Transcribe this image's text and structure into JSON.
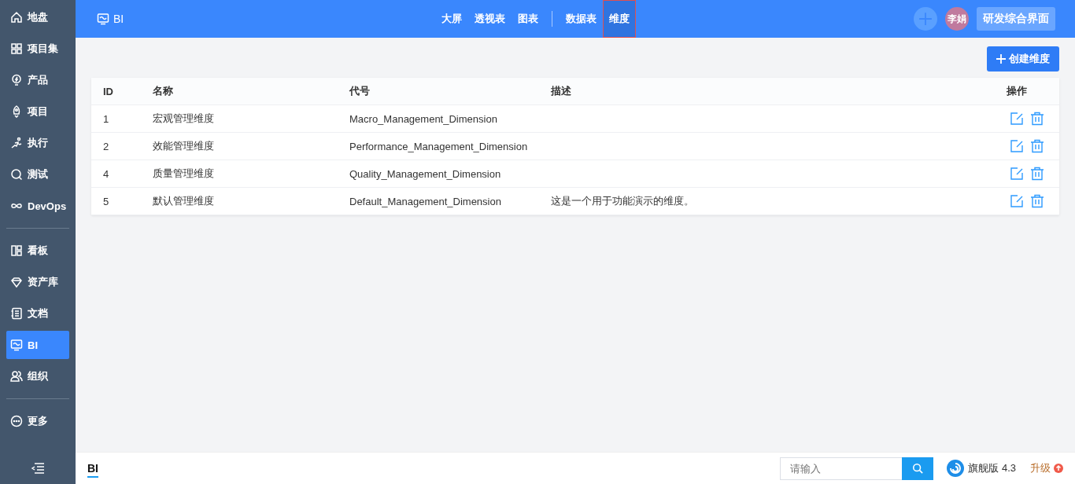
{
  "sidebar": {
    "sections": [
      [
        {
          "label": "地盘",
          "selected": false
        },
        {
          "label": "项目集",
          "selected": false
        },
        {
          "label": "产品",
          "selected": false
        },
        {
          "label": "项目",
          "selected": false
        },
        {
          "label": "执行",
          "selected": false
        },
        {
          "label": "测试",
          "selected": false
        },
        {
          "label": "DevOps",
          "selected": false
        }
      ],
      [
        {
          "label": "看板",
          "selected": false
        },
        {
          "label": "资产库",
          "selected": false
        },
        {
          "label": "文档",
          "selected": false
        },
        {
          "label": "BI",
          "selected": true
        },
        {
          "label": "组织",
          "selected": false
        }
      ],
      [
        {
          "label": "更多",
          "selected": false
        }
      ]
    ]
  },
  "header": {
    "title": "BI",
    "nav_groups": [
      [
        {
          "label": "大屏",
          "selected": false
        },
        {
          "label": "透视表",
          "selected": false
        },
        {
          "label": "图表",
          "selected": false
        }
      ],
      [
        {
          "label": "数据表",
          "selected": false
        },
        {
          "label": "维度",
          "selected": true
        }
      ]
    ],
    "avatar": "李娟",
    "workspace_button": "研发综合界面"
  },
  "create_button": "创建维度",
  "table": {
    "columns": [
      "ID",
      "名称",
      "代号",
      "描述",
      "操作"
    ],
    "rows": [
      [
        "1",
        "宏观管理维度",
        "Macro_Management_Dimension",
        ""
      ],
      [
        "2",
        "效能管理维度",
        "Performance_Management_Dimension",
        ""
      ],
      [
        "4",
        "质量管理维度",
        "Quality_Management_Dimension",
        ""
      ],
      [
        "5",
        "默认管理维度",
        "Default_Management_Dimension",
        "这是一个用于功能演示的维度。"
      ]
    ]
  },
  "footer": {
    "tabs": [
      {
        "label": "BI",
        "selected": true
      }
    ],
    "search": {
      "placeholder": "请输入"
    },
    "edition": "旗舰版 4.3",
    "upgrade": "升级"
  }
}
